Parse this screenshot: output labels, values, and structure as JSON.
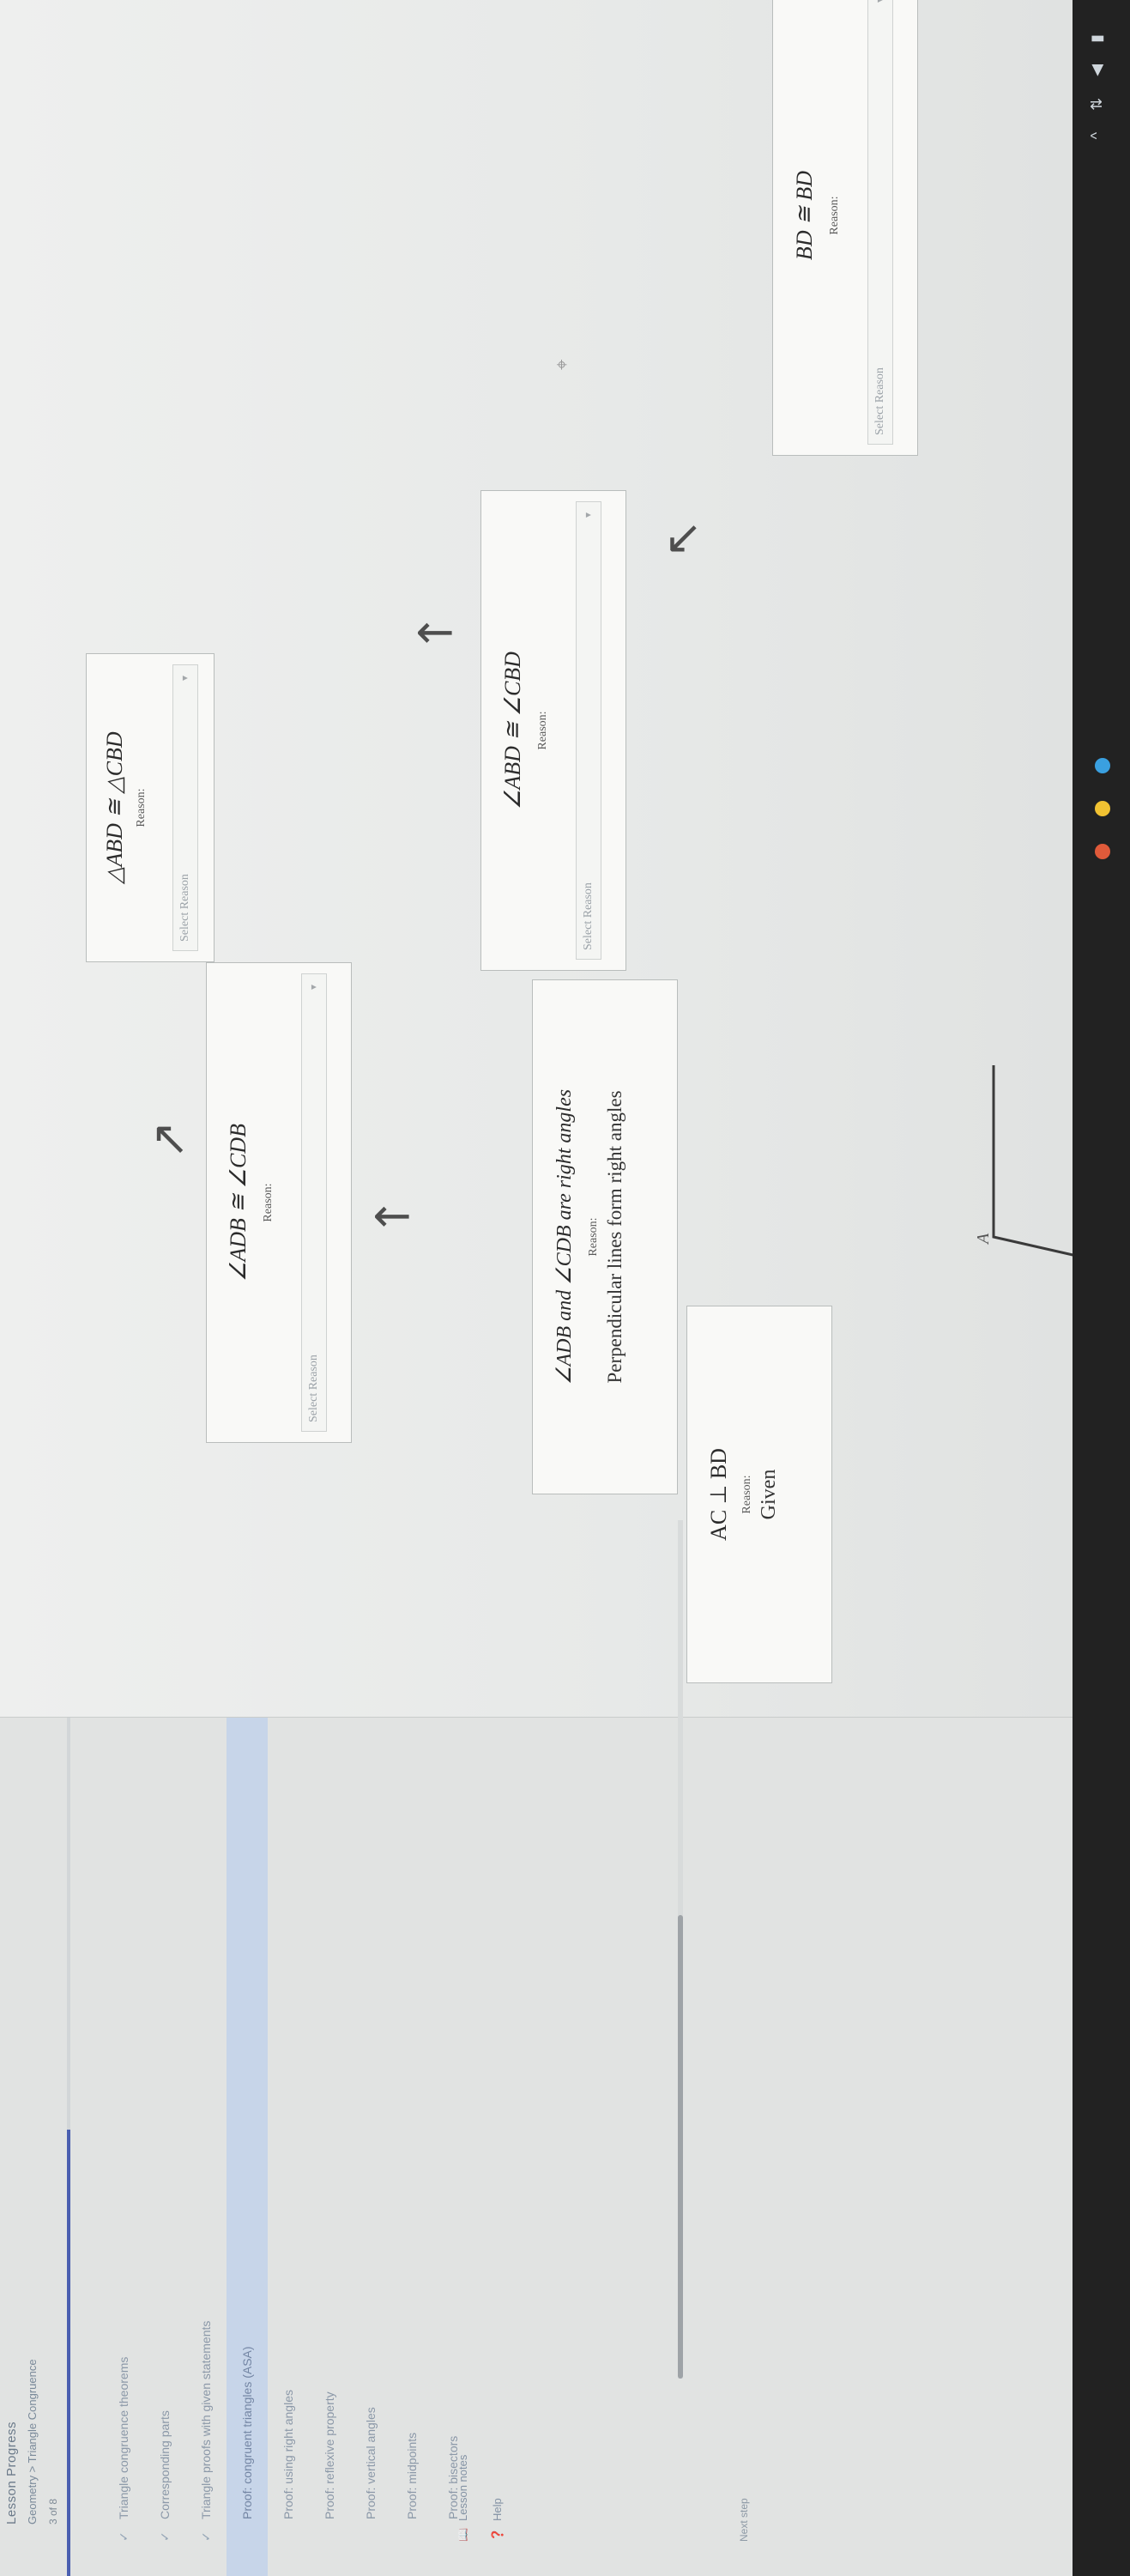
{
  "sidebar": {
    "title": "Lesson Progress",
    "path": "Geometry > Triangle Congruence",
    "count": "3 of 8",
    "progress": 0.52,
    "items": [
      {
        "label": "Triangle congruence theorems",
        "check": "✓",
        "active": false
      },
      {
        "label": "Corresponding parts",
        "check": "✓",
        "active": false
      },
      {
        "label": "Triangle proofs with given statements",
        "check": "✓",
        "active": false
      },
      {
        "label": "Proof: congruent triangles (ASA)",
        "check": "",
        "active": true
      },
      {
        "label": "Proof: using right angles",
        "check": "",
        "active": false
      },
      {
        "label": "Proof: reflexive property",
        "check": "",
        "active": false
      },
      {
        "label": "Proof: vertical angles",
        "check": "",
        "active": false
      },
      {
        "label": "Proof: midpoints",
        "check": "",
        "active": false
      },
      {
        "label": "Proof: bisectors",
        "check": "",
        "active": false
      }
    ],
    "glossary": [
      {
        "icon": "📖",
        "label": "Lesson notes"
      },
      {
        "icon": "❓",
        "label": "Help"
      }
    ],
    "help": "Next step"
  },
  "proof": {
    "reason_label": "Reason:",
    "select_placeholder": "Select Reason",
    "steps": {
      "s1": {
        "statement": "AC ⊥ BD",
        "reason": "Given"
      },
      "s2": {
        "statement": "∠ADB and ∠CDB are right angles",
        "reason": "Perpendicular lines form right angles"
      },
      "s3": {
        "statement": "∠ADB ≅ ∠CDB"
      },
      "s4": {
        "statement": "∠ABD ≅ ∠CBD"
      },
      "s5": {
        "statement": "BD ≅ BD"
      },
      "s6": {
        "statement": "△ABD ≅ △CBD"
      }
    },
    "vertex_label": "A"
  },
  "colors": {
    "accent": "#4a5fb0",
    "active_row": "#c7d5e9"
  }
}
